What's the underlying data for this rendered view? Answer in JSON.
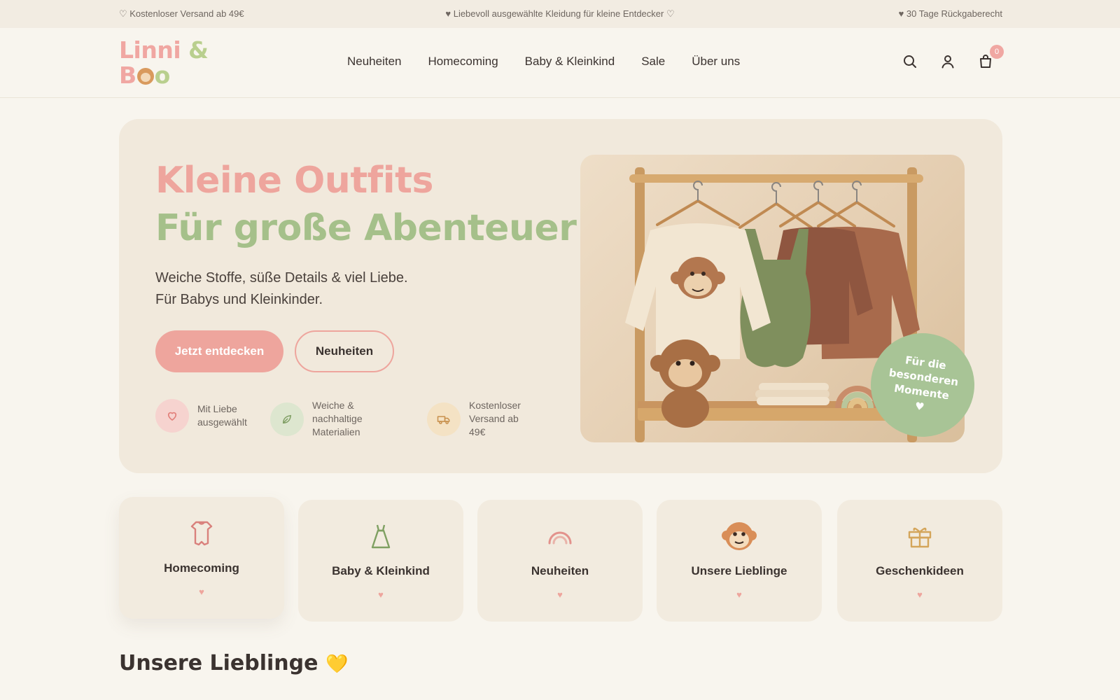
{
  "announcement": {
    "left": "♡ Kostenloser Versand ab 49€",
    "center": "♥ Liebevoll ausgewählte Kleidung für kleine Entdecker ♡",
    "right": "♥ 30 Tage Rückgaberecht"
  },
  "logo": {
    "line1_a": "Linni",
    "line1_b": " &",
    "line2_a": "B",
    "line2_b": "o"
  },
  "nav": [
    {
      "label": "Neuheiten"
    },
    {
      "label": "Homecoming"
    },
    {
      "label": "Baby & Kleinkind"
    },
    {
      "label": "Sale"
    },
    {
      "label": "Über uns"
    }
  ],
  "header_icons": {
    "search": "search-icon",
    "account": "user-icon",
    "cart": "shopping-bag-icon",
    "cart_count": "0"
  },
  "hero": {
    "title_line1": "Kleine Outfits",
    "title_line2": "Für große Abenteuer",
    "subtitle_line1": "Weiche Stoffe, süße Details & viel Liebe.",
    "subtitle_line2": "Für Babys und Kleinkinder.",
    "primary_cta": "Jetzt entdecken",
    "secondary_cta": "Neuheiten",
    "features": [
      {
        "icon": "heart-icon",
        "text": "Mit Liebe ausgewählt"
      },
      {
        "icon": "leaf-icon",
        "text": "Weiche & nachhaltige Materialien"
      },
      {
        "icon": "truck-icon",
        "text": "Kostenloser Versand ab 49€"
      }
    ],
    "badge_line1": "Für die",
    "badge_line2": "besonderen",
    "badge_line3": "Momente",
    "badge_heart": "♥"
  },
  "categories": [
    {
      "label": "Homecoming",
      "icon": "bodysuit-icon",
      "heart": "♥"
    },
    {
      "label": "Baby & Kleinkind",
      "icon": "dress-icon",
      "heart": "♥"
    },
    {
      "label": "Neuheiten",
      "icon": "rainbow-icon",
      "heart": "♥"
    },
    {
      "label": "Unsere Lieblinge",
      "icon": "monkey-icon",
      "heart": "♥"
    },
    {
      "label": "Geschenkideen",
      "icon": "gift-icon",
      "heart": "♥"
    }
  ],
  "section": {
    "title": "Unsere Lieblinge",
    "emoji": "💛"
  },
  "colors": {
    "background": "#f8f5ee",
    "pink": "#eea59d",
    "green": "#a5c08a",
    "card": "#f2ebdf"
  }
}
